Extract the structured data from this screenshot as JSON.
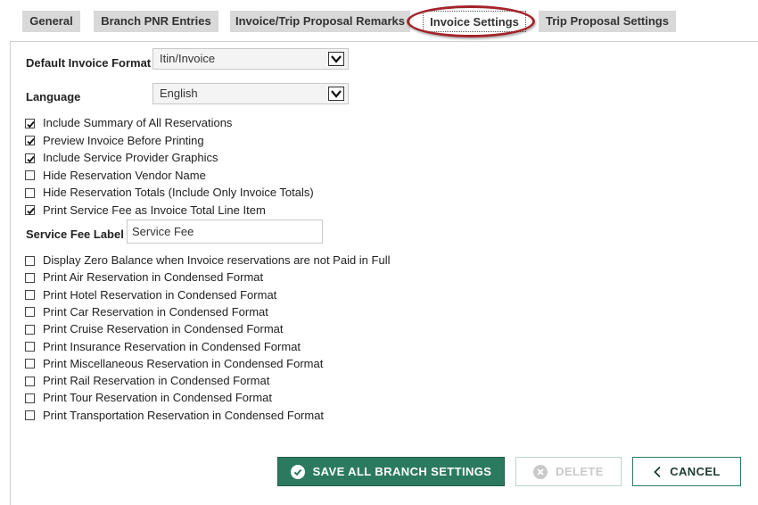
{
  "tabs": [
    {
      "label": "General"
    },
    {
      "label": "Branch PNR Entries"
    },
    {
      "label": "Invoice/Trip Proposal Remarks"
    },
    {
      "label": "Invoice Settings"
    },
    {
      "label": "Trip Proposal Settings"
    }
  ],
  "form": {
    "default_invoice_format_label": "Default Invoice Format",
    "default_invoice_format_value": "Itin/Invoice",
    "language_label": "Language",
    "language_value": "English",
    "service_fee_label": "Service Fee Label",
    "service_fee_value": "Service Fee"
  },
  "checkboxes_top": [
    {
      "label": "Include Summary of All Reservations",
      "checked": true
    },
    {
      "label": "Preview Invoice Before Printing",
      "checked": true
    },
    {
      "label": "Include Service Provider Graphics",
      "checked": true
    },
    {
      "label": "Hide Reservation Vendor Name",
      "checked": false
    },
    {
      "label": "Hide Reservation Totals (Include Only Invoice Totals)",
      "checked": false
    },
    {
      "label": "Print Service Fee as Invoice Total Line Item",
      "checked": true
    }
  ],
  "checkboxes_bottom": [
    {
      "label": "Display Zero Balance when Invoice reservations are not Paid in Full",
      "checked": false
    },
    {
      "label": "Print Air Reservation in Condensed Format",
      "checked": false
    },
    {
      "label": "Print Hotel Reservation in Condensed Format",
      "checked": false
    },
    {
      "label": "Print Car Reservation in Condensed Format",
      "checked": false
    },
    {
      "label": "Print Cruise Reservation in Condensed Format",
      "checked": false
    },
    {
      "label": "Print Insurance Reservation in Condensed Format",
      "checked": false
    },
    {
      "label": "Print Miscellaneous Reservation in Condensed Format",
      "checked": false
    },
    {
      "label": "Print Rail Reservation in Condensed Format",
      "checked": false
    },
    {
      "label": "Print Tour Reservation in Condensed Format",
      "checked": false
    },
    {
      "label": "Print Transportation Reservation in Condensed Format",
      "checked": false
    }
  ],
  "buttons": {
    "save_label": "SAVE ALL BRANCH SETTINGS",
    "delete_label": "DELETE",
    "cancel_label": "CANCEL"
  },
  "colors": {
    "accent": "#2b7a5f",
    "highlight_ring": "#a3242b",
    "tab_bg": "#d9d9d9"
  }
}
